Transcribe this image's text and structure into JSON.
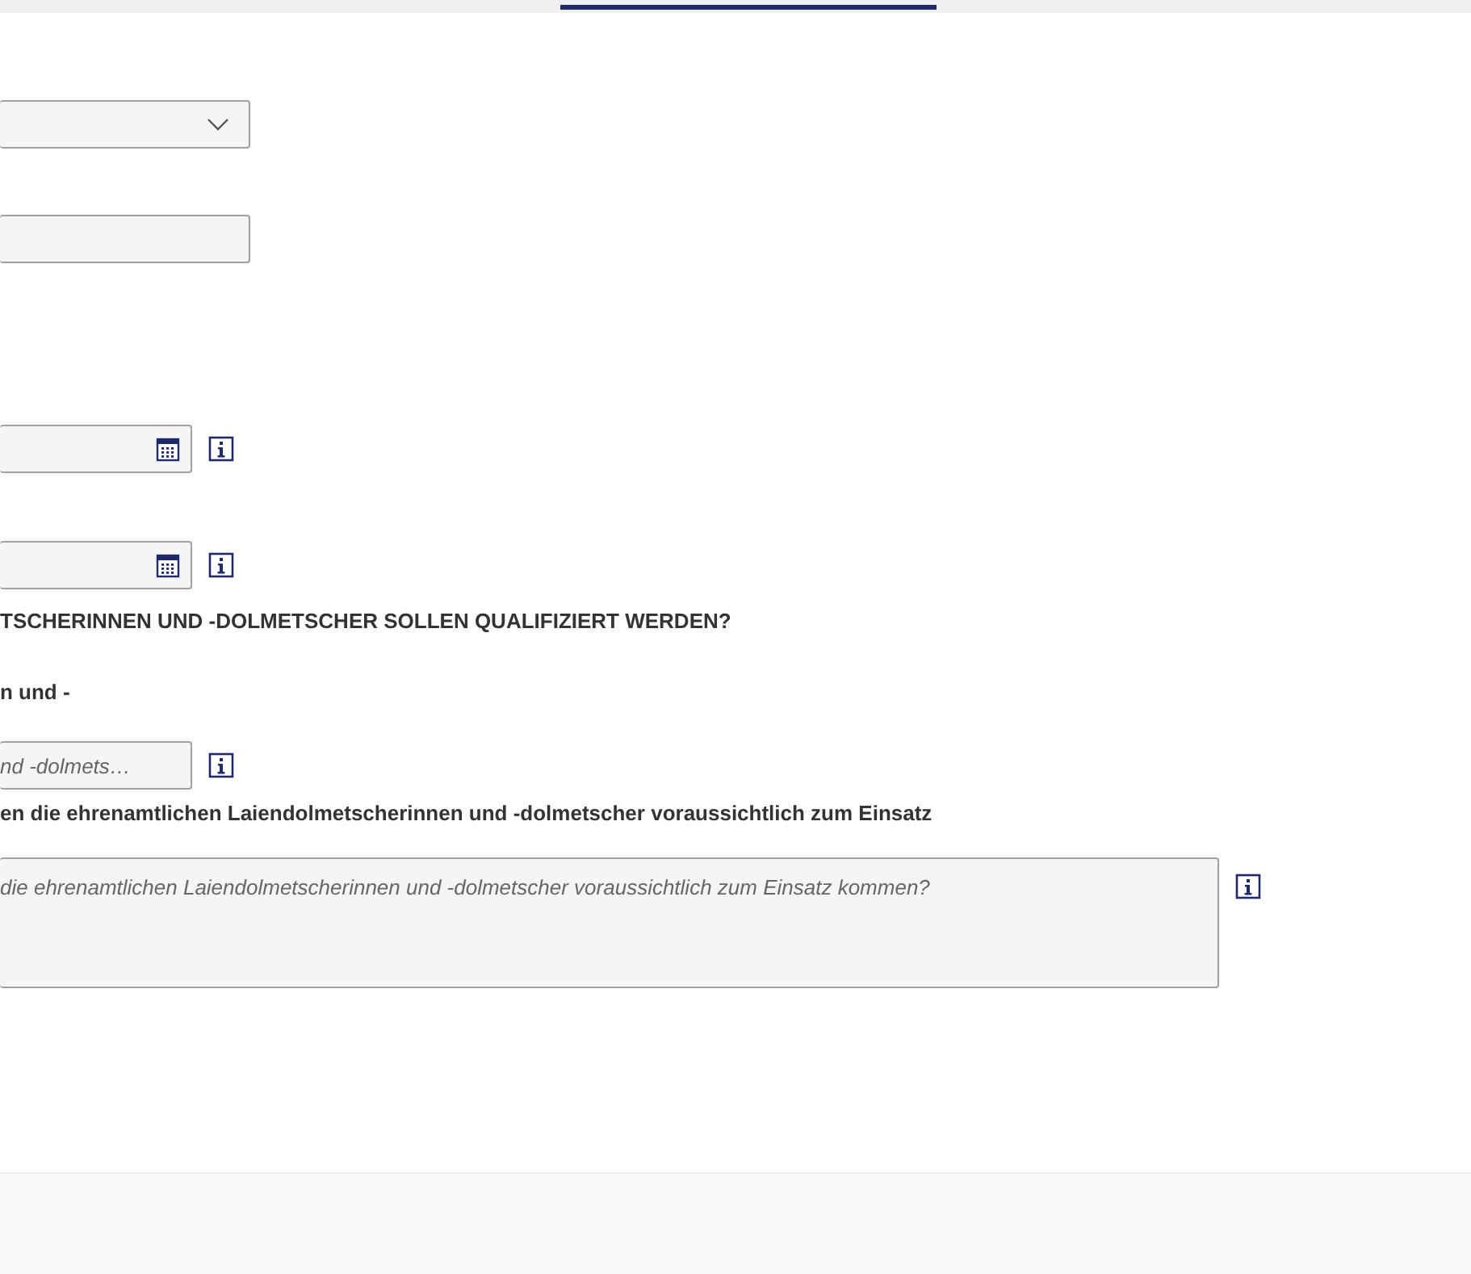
{
  "form": {
    "fields": [
      {
        "kind": "select"
      },
      {
        "kind": "text"
      },
      {
        "kind": "date",
        "info": true
      },
      {
        "kind": "date",
        "info": true
      },
      {
        "kind": "heading",
        "text": "TSCHERINNEN UND -DOLMETSCHER SOLLEN QUALIFIZIERT WERDEN?"
      },
      {
        "kind": "label",
        "text": "n und -"
      },
      {
        "kind": "text",
        "placeholder": "nd -dolmets…",
        "info": true
      },
      {
        "kind": "label",
        "text": "en die ehrenamtlichen Laiendolmetscherinnen und -dolmetscher voraussichtlich zum Einsatz"
      },
      {
        "kind": "textarea",
        "placeholder": "die ehrenamtlichen Laiendolmetscherinnen und -dolmetscher voraussichtlich zum Einsatz kommen?",
        "info": true
      }
    ]
  }
}
